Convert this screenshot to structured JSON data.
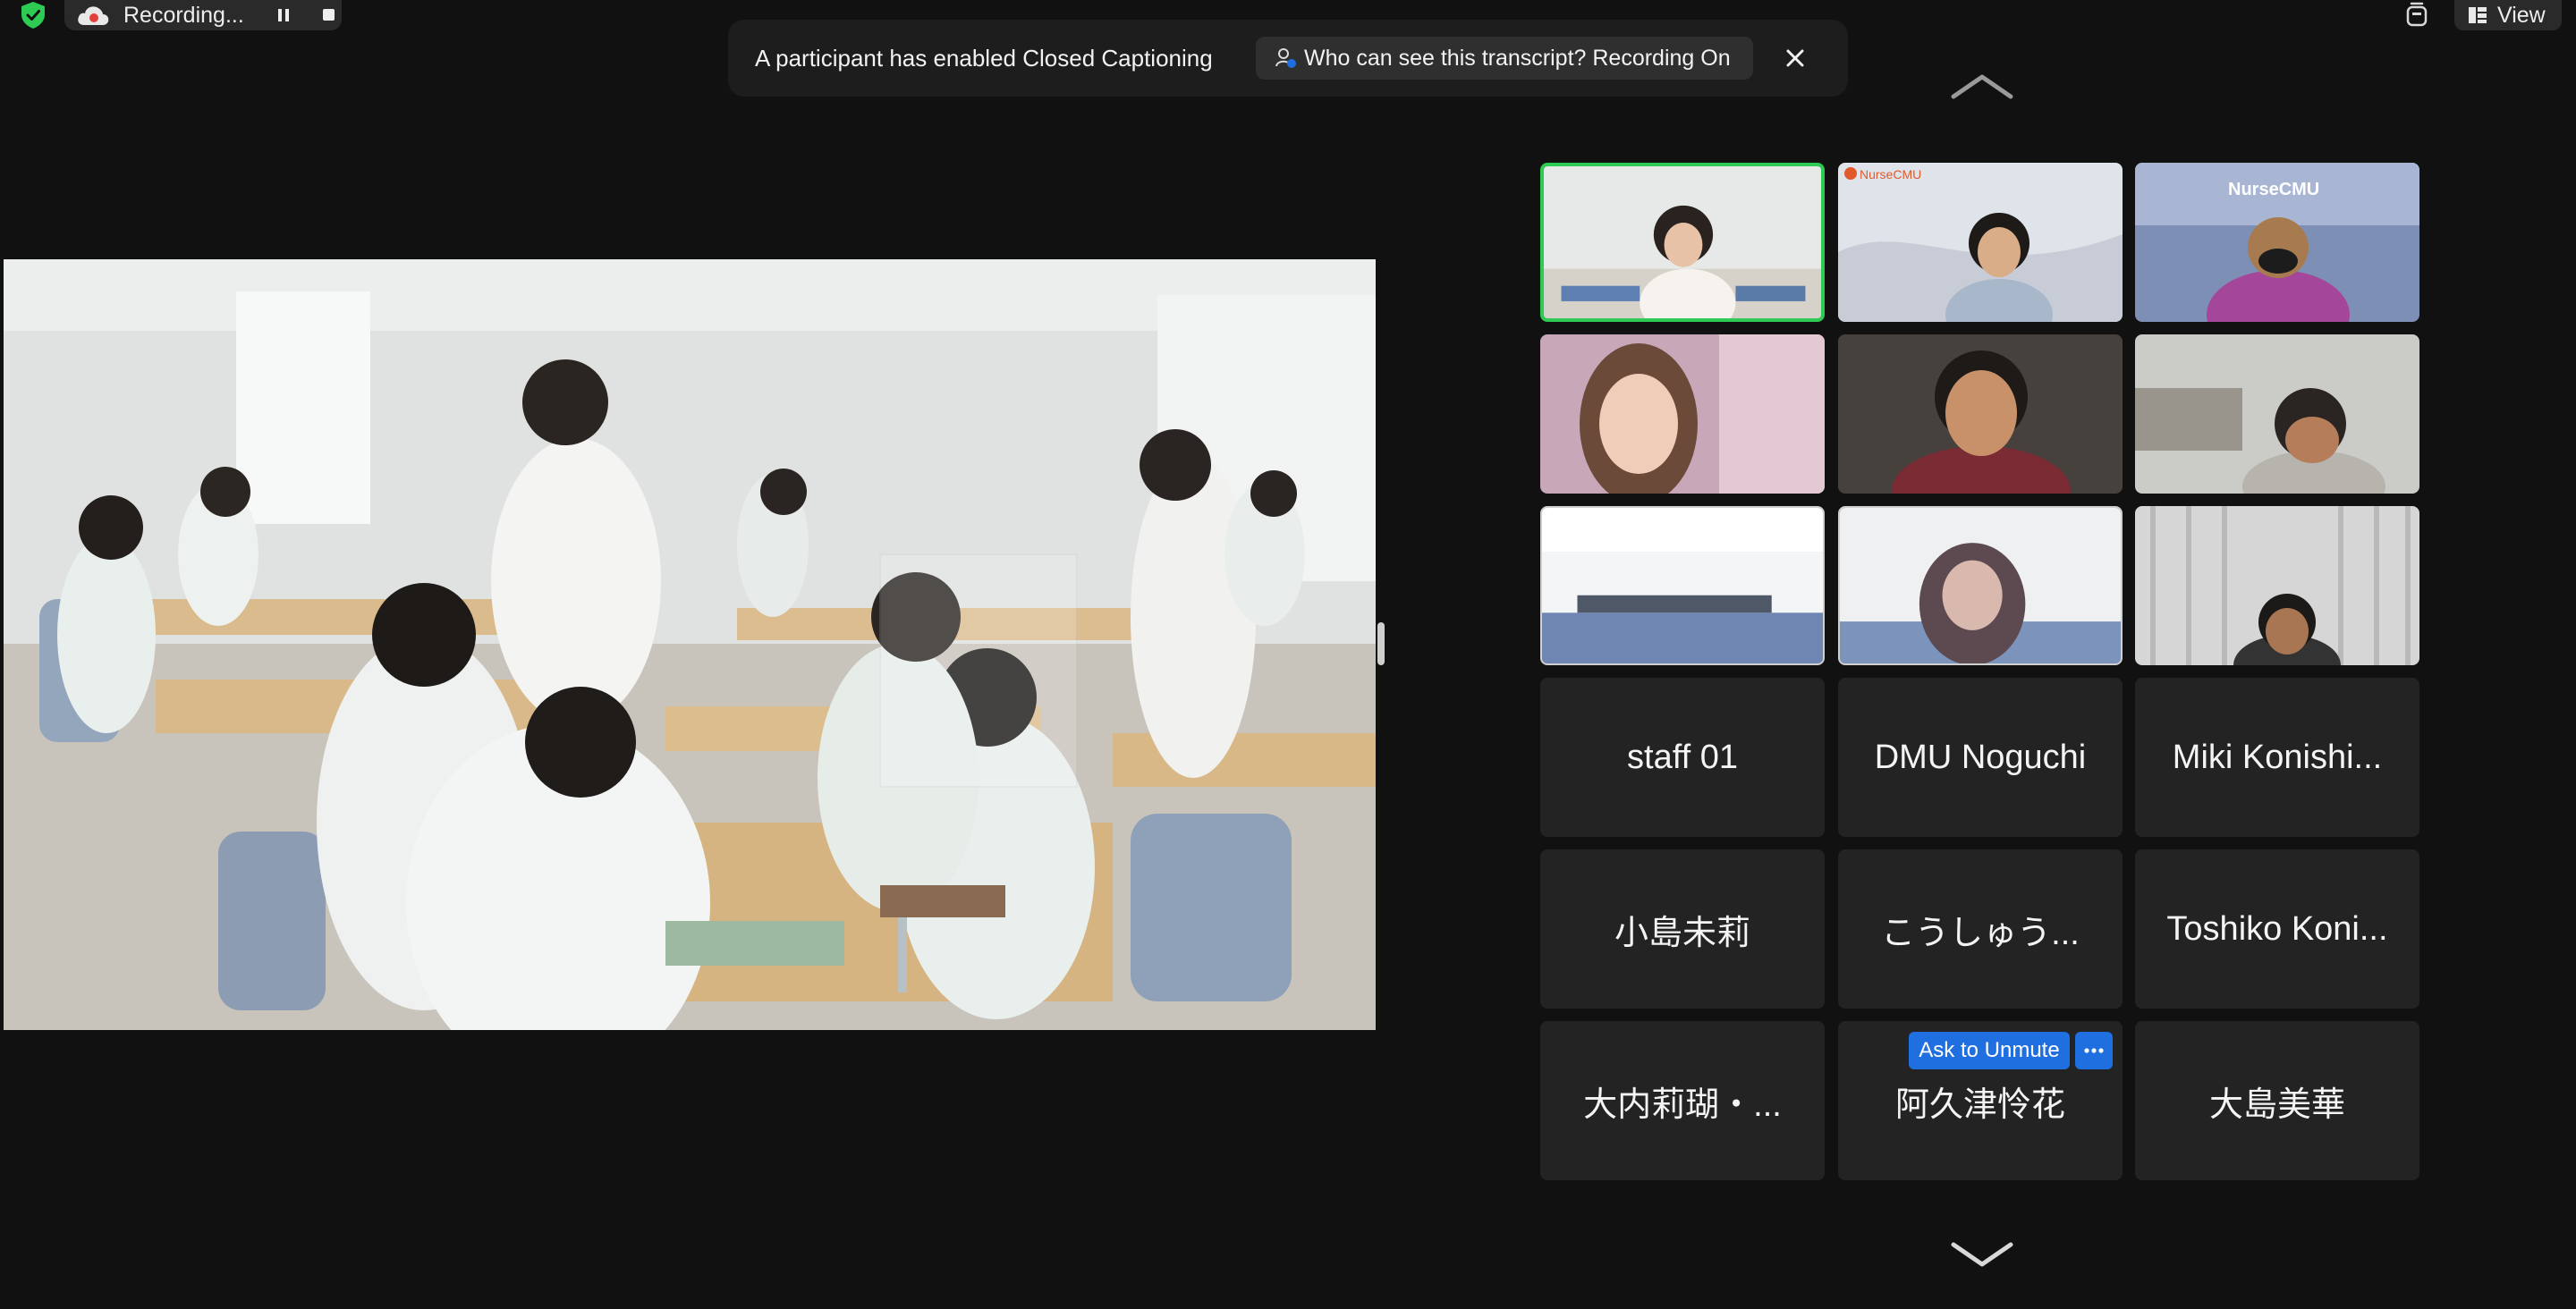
{
  "recording": {
    "label": "Recording...",
    "state": "recording"
  },
  "top_right": {
    "view_label": "View"
  },
  "caption_banner": {
    "message": "A participant has enabled Closed Captioning",
    "info_button": "Who can see this transcript? Recording On"
  },
  "share": {
    "description_icon": "classroom-video"
  },
  "tiles": [
    {
      "type": "video",
      "active": true
    },
    {
      "type": "video",
      "logo_text": "NurseCMU"
    },
    {
      "type": "video",
      "logo_text": "NurseCMU"
    },
    {
      "type": "video"
    },
    {
      "type": "video"
    },
    {
      "type": "video"
    },
    {
      "type": "video"
    },
    {
      "type": "video"
    },
    {
      "type": "video"
    },
    {
      "type": "name",
      "name": "staff 01"
    },
    {
      "type": "name",
      "name": "DMU Noguchi"
    },
    {
      "type": "name",
      "name": "Miki Konishi..."
    },
    {
      "type": "name",
      "name": "小島未莉"
    },
    {
      "type": "name",
      "name": "こうしゅう..."
    },
    {
      "type": "name",
      "name": "Toshiko Koni..."
    },
    {
      "type": "name",
      "name": "大内莉瑚・..."
    },
    {
      "type": "name",
      "name": "阿久津怜花"
    },
    {
      "type": "name",
      "name": "大島美華"
    }
  ],
  "hover": {
    "ask_unmute": "Ask to Unmute"
  },
  "colors": {
    "active_speaker": "#2dcb54",
    "accent_blue": "#1f6fe0",
    "background": "#111111"
  }
}
